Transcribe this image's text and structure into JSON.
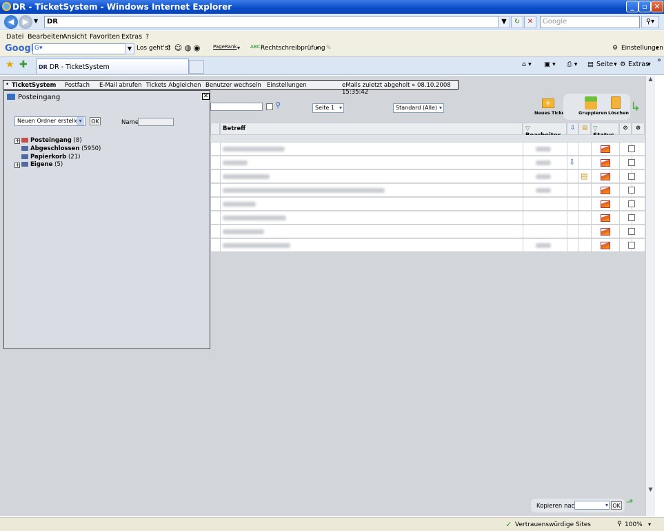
{
  "window": {
    "title": "DR - TicketSystem - Windows Internet Explorer",
    "min_btn": "_",
    "max_btn": "▫",
    "close_btn": "✕"
  },
  "address": {
    "url": "DR",
    "search_placeholder": "Google"
  },
  "menubar": {
    "items": [
      "Datei",
      "Bearbeiten",
      "Ansicht",
      "Favoriten",
      "Extras",
      "?"
    ]
  },
  "google_toolbar": {
    "logo": "Google",
    "g_button": "G▾",
    "go": "Los geht's!",
    "pagerank": "PageRank",
    "spell": "Rechtschreibprüfung",
    "settings": "Einstellungen"
  },
  "tabs": {
    "active_label": "DR - TicketSystem",
    "tab_badge": "DR"
  },
  "ie_tools": {
    "seite": "Seite",
    "extras": "Extras"
  },
  "app_menu": {
    "items": [
      "TicketSystem",
      "Postfach",
      "E-Mail abrufen",
      "Tickets Abgleichen",
      "Benutzer wechseln",
      "Einstellungen"
    ],
    "last_fetch": "eMails zuletzt abgeholt » 08.10.2008 15:35:42"
  },
  "folder_panel": {
    "title": "Posteingang",
    "close": "✕",
    "new_folder_select": "Neuen Ordner erstellen",
    "ok": "OK",
    "name_label": "Name:",
    "tree": [
      {
        "name": "Posteingang",
        "count": "(8)",
        "expandable": true,
        "color": "#c0504d"
      },
      {
        "name": "Abgeschlossen",
        "count": "(5950)",
        "expandable": false,
        "color": "#4f6a9e"
      },
      {
        "name": "Papierkorb",
        "count": "(21)",
        "expandable": false,
        "color": "#4f6a9e"
      },
      {
        "name": "Eigene",
        "count": "(5)",
        "expandable": true,
        "color": "#4f6a9e"
      }
    ]
  },
  "controls": {
    "page_select": "Seite 1",
    "view_select": "Standard (Alle)",
    "new_ticket": "Neues Ticket",
    "group": "Gruppieren",
    "delete": "Löschen"
  },
  "table": {
    "col_subject": "Betreff",
    "col_agent": "Bearbeiter",
    "col_status": "Status",
    "rows": 8
  },
  "footer": {
    "copy_label": "Kopieren nach",
    "ok": "OK"
  },
  "statusbar": {
    "zone": "Vertrauenswürdige Sites",
    "zoom": "100%"
  }
}
